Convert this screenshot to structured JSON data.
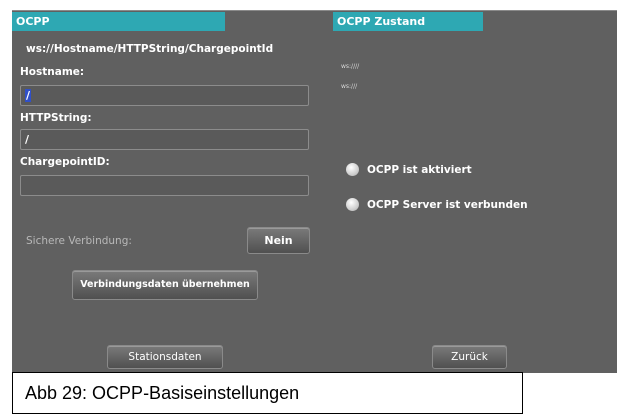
{
  "left_panel": {
    "header": "OCPP",
    "url_template": "ws://Hostname/HTTPString/ChargepointId",
    "hostname": {
      "label": "Hostname:",
      "value": "/"
    },
    "httpstring": {
      "label": "HTTPString:",
      "value": "/"
    },
    "chargepoint": {
      "label": "ChargepointID:",
      "value": ""
    },
    "secure": {
      "label": "Sichere Verbindung:",
      "button": "Nein"
    },
    "apply_button": "Verbindungsdaten übernehmen",
    "station_button": "Stationsdaten"
  },
  "right_panel": {
    "header": "OCPP Zustand",
    "url1": "ws:////",
    "url2": "ws:///",
    "status_activated": "OCPP ist aktiviert",
    "status_connected": "OCPP Server ist verbunden",
    "back_button": "Zurück"
  },
  "colors": {
    "header": "#2ea8b3",
    "background": "#606060",
    "led_off": "#d0d0d0"
  },
  "caption": "Abb 29: OCPP-Basiseinstellungen"
}
